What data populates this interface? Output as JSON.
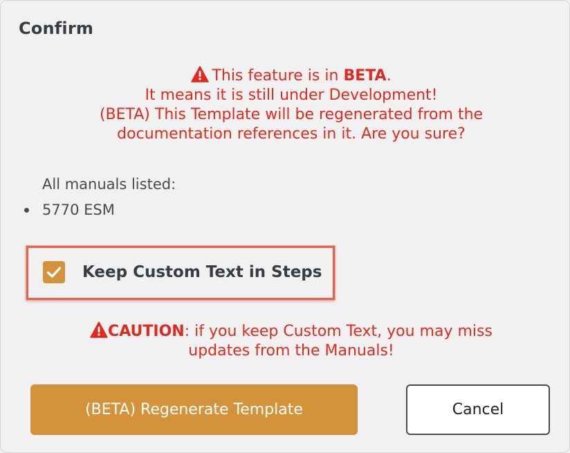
{
  "dialog": {
    "title": "Confirm"
  },
  "beta_warning": {
    "icon": "warning-triangle-icon",
    "line1_prefix": "This feature is in ",
    "line1_bold": "BETA",
    "line1_suffix": ".",
    "line2": "It means it is still under Development!",
    "line3": "(BETA) This Template will be regenerated from the",
    "line4": "documentation references in it. Are you sure?"
  },
  "manuals": {
    "label": "All manuals listed:",
    "items": [
      "5770 ESM"
    ]
  },
  "keep_custom_text": {
    "label": "Keep Custom Text in Steps",
    "checked": true
  },
  "caution": {
    "icon": "warning-triangle-icon",
    "bold": "CAUTION",
    "line1_suffix": ": if you keep Custom Text, you may miss",
    "line2": "updates from the Manuals!"
  },
  "actions": {
    "regenerate_label": "(BETA) Regenerate Template",
    "cancel_label": "Cancel"
  },
  "colors": {
    "accent": "#d4933b",
    "warning_text": "#e0291f",
    "highlight_border": "#e8614e",
    "background": "#f1f1f1"
  }
}
